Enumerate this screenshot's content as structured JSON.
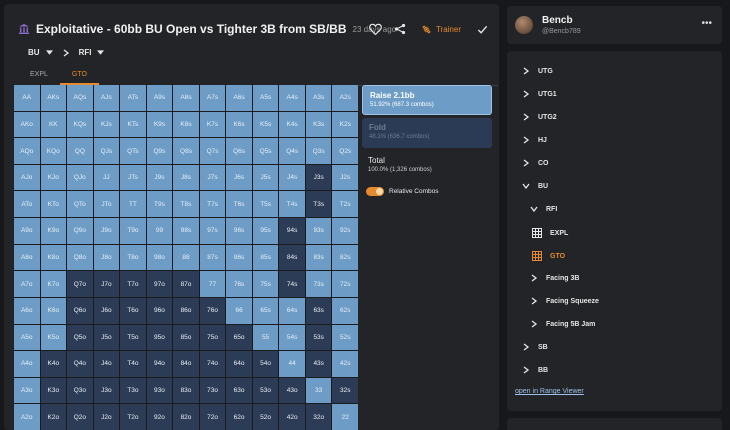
{
  "header": {
    "title": "Exploitative - 60bb BU Open vs Tighter 3B from SB/BB",
    "date": "23 days ago",
    "trainer_label": "Trainer"
  },
  "breadcrumb": [
    {
      "label": "BU"
    },
    {
      "label": "RFI"
    }
  ],
  "tabs": [
    {
      "label": "EXPL",
      "active": false
    },
    {
      "label": "GTO",
      "active": true
    }
  ],
  "colors": {
    "raise": "#6d9dc7",
    "fold": "#2d3c56",
    "accent": "#e58a2e"
  },
  "grid": {
    "rows": [
      [
        [
          "AA",
          "r"
        ],
        [
          "AKs",
          "r"
        ],
        [
          "AQs",
          "r"
        ],
        [
          "AJs",
          "r"
        ],
        [
          "ATs",
          "r"
        ],
        [
          "A9s",
          "r"
        ],
        [
          "A8s",
          "r"
        ],
        [
          "A7s",
          "r"
        ],
        [
          "A6s",
          "r"
        ],
        [
          "A5s",
          "r"
        ],
        [
          "A4s",
          "r"
        ],
        [
          "A3s",
          "r"
        ],
        [
          "A2s",
          "r"
        ]
      ],
      [
        [
          "AKo",
          "r"
        ],
        [
          "KK",
          "r"
        ],
        [
          "KQs",
          "r"
        ],
        [
          "KJs",
          "r"
        ],
        [
          "KTs",
          "r"
        ],
        [
          "K9s",
          "r"
        ],
        [
          "K8s",
          "r"
        ],
        [
          "K7s",
          "r"
        ],
        [
          "K6s",
          "r"
        ],
        [
          "K5s",
          "r"
        ],
        [
          "K4s",
          "r"
        ],
        [
          "K3s",
          "r"
        ],
        [
          "K2s",
          "r"
        ]
      ],
      [
        [
          "AQo",
          "r"
        ],
        [
          "KQo",
          "r"
        ],
        [
          "QQ",
          "r"
        ],
        [
          "QJs",
          "r"
        ],
        [
          "QTs",
          "r"
        ],
        [
          "Q9s",
          "r"
        ],
        [
          "Q8s",
          "r"
        ],
        [
          "Q7s",
          "r"
        ],
        [
          "Q6s",
          "r"
        ],
        [
          "Q5s",
          "r"
        ],
        [
          "Q4s",
          "r"
        ],
        [
          "Q3s",
          "r"
        ],
        [
          "Q2s",
          "r"
        ]
      ],
      [
        [
          "AJo",
          "r"
        ],
        [
          "KJo",
          "r"
        ],
        [
          "QJo",
          "r"
        ],
        [
          "JJ",
          "r"
        ],
        [
          "JTs",
          "r"
        ],
        [
          "J9s",
          "r"
        ],
        [
          "J8s",
          "r"
        ],
        [
          "J7s",
          "r"
        ],
        [
          "J6s",
          "r"
        ],
        [
          "J5s",
          "r"
        ],
        [
          "J4s",
          "r"
        ],
        [
          "J3s",
          "f"
        ],
        [
          "J2s",
          "r"
        ]
      ],
      [
        [
          "ATo",
          "r"
        ],
        [
          "KTo",
          "r"
        ],
        [
          "QTo",
          "r"
        ],
        [
          "JTo",
          "r"
        ],
        [
          "TT",
          "r"
        ],
        [
          "T9s",
          "r"
        ],
        [
          "T8s",
          "r"
        ],
        [
          "T7s",
          "r"
        ],
        [
          "T6s",
          "r"
        ],
        [
          "T5s",
          "r"
        ],
        [
          "T4s",
          "r"
        ],
        [
          "T3s",
          "f"
        ],
        [
          "T2s",
          "r"
        ]
      ],
      [
        [
          "A9o",
          "r"
        ],
        [
          "K9o",
          "r"
        ],
        [
          "Q9o",
          "r"
        ],
        [
          "J9o",
          "r"
        ],
        [
          "T9o",
          "r"
        ],
        [
          "99",
          "r"
        ],
        [
          "98s",
          "r"
        ],
        [
          "97s",
          "r"
        ],
        [
          "96s",
          "r"
        ],
        [
          "95s",
          "r"
        ],
        [
          "94s",
          "f"
        ],
        [
          "93s",
          "r"
        ],
        [
          "92s",
          "r"
        ]
      ],
      [
        [
          "A8o",
          "r"
        ],
        [
          "K8o",
          "r"
        ],
        [
          "Q8o",
          "r"
        ],
        [
          "J8o",
          "r"
        ],
        [
          "T8o",
          "r"
        ],
        [
          "98o",
          "r"
        ],
        [
          "88",
          "r"
        ],
        [
          "87s",
          "r"
        ],
        [
          "86s",
          "r"
        ],
        [
          "85s",
          "r"
        ],
        [
          "84s",
          "f"
        ],
        [
          "83s",
          "r"
        ],
        [
          "82s",
          "r"
        ]
      ],
      [
        [
          "A7o",
          "r"
        ],
        [
          "K7o",
          "r"
        ],
        [
          "Q7o",
          "f"
        ],
        [
          "J7o",
          "f"
        ],
        [
          "T7o",
          "f"
        ],
        [
          "97o",
          "f"
        ],
        [
          "87o",
          "f"
        ],
        [
          "77",
          "r"
        ],
        [
          "76s",
          "r"
        ],
        [
          "75s",
          "r"
        ],
        [
          "74s",
          "f"
        ],
        [
          "73s",
          "r"
        ],
        [
          "72s",
          "r"
        ]
      ],
      [
        [
          "A6o",
          "r"
        ],
        [
          "K6o",
          "r"
        ],
        [
          "Q6o",
          "f"
        ],
        [
          "J6o",
          "f"
        ],
        [
          "T6o",
          "f"
        ],
        [
          "96o",
          "f"
        ],
        [
          "86o",
          "f"
        ],
        [
          "76o",
          "f"
        ],
        [
          "66",
          "r"
        ],
        [
          "65s",
          "r"
        ],
        [
          "64s",
          "r"
        ],
        [
          "63s",
          "f"
        ],
        [
          "62s",
          "r"
        ]
      ],
      [
        [
          "A5o",
          "r"
        ],
        [
          "K5o",
          "r"
        ],
        [
          "Q5o",
          "f"
        ],
        [
          "J5o",
          "f"
        ],
        [
          "T5o",
          "f"
        ],
        [
          "95o",
          "f"
        ],
        [
          "85o",
          "f"
        ],
        [
          "75o",
          "f"
        ],
        [
          "65o",
          "f"
        ],
        [
          "55",
          "r"
        ],
        [
          "54s",
          "r"
        ],
        [
          "53s",
          "f"
        ],
        [
          "52s",
          "r"
        ]
      ],
      [
        [
          "A4o",
          "r"
        ],
        [
          "K4o",
          "f"
        ],
        [
          "Q4o",
          "f"
        ],
        [
          "J4o",
          "f"
        ],
        [
          "T4o",
          "f"
        ],
        [
          "94o",
          "f"
        ],
        [
          "84o",
          "f"
        ],
        [
          "74o",
          "f"
        ],
        [
          "64o",
          "f"
        ],
        [
          "54o",
          "f"
        ],
        [
          "44",
          "r"
        ],
        [
          "43s",
          "f"
        ],
        [
          "42s",
          "r"
        ]
      ],
      [
        [
          "A3o",
          "r"
        ],
        [
          "K3o",
          "f"
        ],
        [
          "Q3o",
          "f"
        ],
        [
          "J3o",
          "f"
        ],
        [
          "T3o",
          "f"
        ],
        [
          "93o",
          "f"
        ],
        [
          "83o",
          "f"
        ],
        [
          "73o",
          "f"
        ],
        [
          "63o",
          "f"
        ],
        [
          "53o",
          "f"
        ],
        [
          "43o",
          "f"
        ],
        [
          "33",
          "r"
        ],
        [
          "32s",
          "f"
        ]
      ],
      [
        [
          "A2o",
          "r"
        ],
        [
          "K2o",
          "f"
        ],
        [
          "Q2o",
          "f"
        ],
        [
          "J2o",
          "f"
        ],
        [
          "T2o",
          "f"
        ],
        [
          "92o",
          "f"
        ],
        [
          "82o",
          "f"
        ],
        [
          "72o",
          "f"
        ],
        [
          "62o",
          "f"
        ],
        [
          "52o",
          "f"
        ],
        [
          "42o",
          "f"
        ],
        [
          "32o",
          "f"
        ],
        [
          "22",
          "r"
        ]
      ]
    ]
  },
  "actions": {
    "raise": {
      "label": "Raise 2.1bb",
      "freq": "51.92% (687.3 combos)"
    },
    "fold": {
      "label": "Fold",
      "freq": "48.1% (636.7 combos)"
    },
    "total": {
      "label": "Total",
      "freq": "100.0% (1,326 combos)"
    },
    "relative_combos_label": "Relative Combos",
    "relative_combos_on": true
  },
  "user": {
    "name": "Bencb",
    "handle": "@Bencb789"
  },
  "tree": [
    {
      "label": "UTG",
      "indent": 0,
      "icon": "chevron-right"
    },
    {
      "label": "UTG1",
      "indent": 0,
      "icon": "chevron-right"
    },
    {
      "label": "UTG2",
      "indent": 0,
      "icon": "chevron-right"
    },
    {
      "label": "HJ",
      "indent": 0,
      "icon": "chevron-right"
    },
    {
      "label": "CO",
      "indent": 0,
      "icon": "chevron-right"
    },
    {
      "label": "BU",
      "indent": 0,
      "icon": "chevron-down"
    },
    {
      "label": "RFI",
      "indent": 1,
      "icon": "chevron-down"
    },
    {
      "label": "EXPL",
      "indent": 1,
      "icon": "grid",
      "extra": 2
    },
    {
      "label": "GTO",
      "indent": 1,
      "icon": "grid",
      "extra": 2,
      "active": true
    },
    {
      "label": "Facing 3B",
      "indent": 1,
      "icon": "chevron-right"
    },
    {
      "label": "Facing Squeeze",
      "indent": 1,
      "icon": "chevron-right"
    },
    {
      "label": "Facing 5B Jam",
      "indent": 1,
      "icon": "chevron-right"
    },
    {
      "label": "SB",
      "indent": 0,
      "icon": "chevron-right"
    },
    {
      "label": "BB",
      "indent": 0,
      "icon": "chevron-right"
    }
  ],
  "range_viewer_link": "open in Range Viewer"
}
